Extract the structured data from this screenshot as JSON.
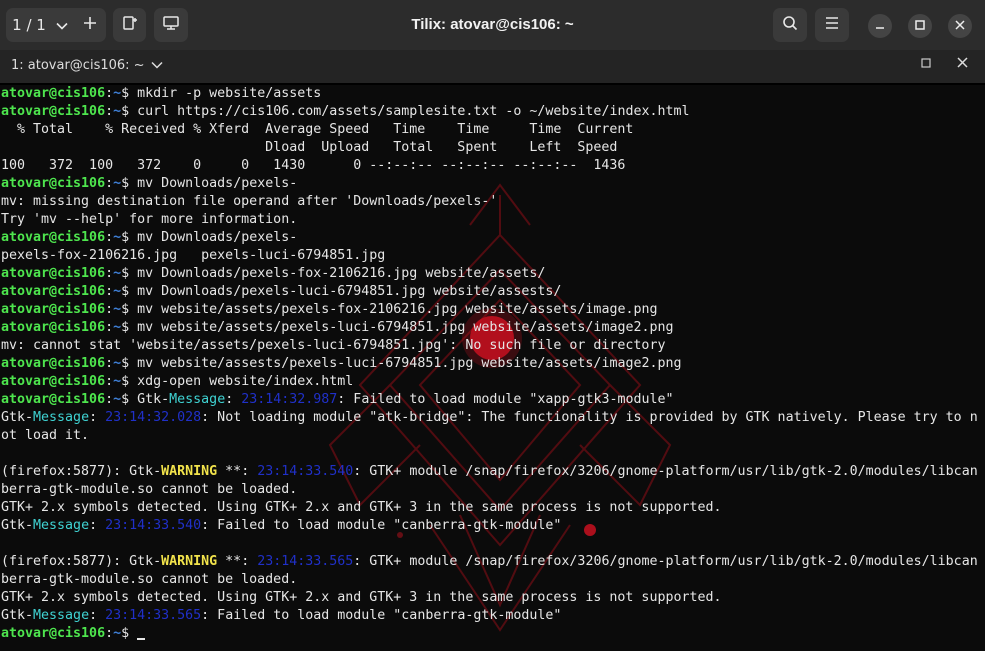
{
  "window": {
    "title": "Tilix: atovar@cis106: ~",
    "session_selector": "1 / 1",
    "tab_label": "1: atovar@cis106: ~"
  },
  "icons": {
    "add": "plus-icon",
    "split": "split-terminal-icon",
    "display": "display-icon",
    "search": "search-icon",
    "menu": "hamburger-menu-icon",
    "minimize": "minimize-icon",
    "maximize": "maximize-icon",
    "close": "close-icon",
    "chevron": "chevron-down-icon"
  },
  "colors": {
    "prompt_user": "#4ee64e",
    "prompt_path": "#3f7fd6",
    "gtk_message": "#3fd3d3",
    "gtk_warning": "#f2e34b",
    "timestamp": "#2030c8",
    "background": "#0b0b0b"
  },
  "terminal": {
    "lines": [
      {
        "type": "prompt",
        "user": "atovar@cis106",
        "path": "~",
        "cmd": "mkdir -p website/assets"
      },
      {
        "type": "prompt",
        "user": "atovar@cis106",
        "path": "~",
        "cmd": "curl https://cis106.com/assets/samplesite.txt -o ~/website/index.html"
      },
      {
        "type": "text",
        "text": "  % Total    % Received % Xferd  Average Speed   Time    Time     Time  Current"
      },
      {
        "type": "text",
        "text": "                                 Dload  Upload   Total   Spent    Left  Speed"
      },
      {
        "type": "text",
        "text": "100   372  100   372    0     0   1430      0 --:--:-- --:--:-- --:--:--  1436"
      },
      {
        "type": "prompt",
        "user": "atovar@cis106",
        "path": "~",
        "cmd": "mv Downloads/pexels-"
      },
      {
        "type": "text",
        "text": "mv: missing destination file operand after 'Downloads/pexels-'"
      },
      {
        "type": "text",
        "text": "Try 'mv --help' for more information."
      },
      {
        "type": "prompt",
        "user": "atovar@cis106",
        "path": "~",
        "cmd": "mv Downloads/pexels-"
      },
      {
        "type": "text",
        "text": "pexels-fox-2106216.jpg   pexels-luci-6794851.jpg"
      },
      {
        "type": "prompt",
        "user": "atovar@cis106",
        "path": "~",
        "cmd": "mv Downloads/pexels-fox-2106216.jpg website/assets/"
      },
      {
        "type": "prompt",
        "user": "atovar@cis106",
        "path": "~",
        "cmd": "mv Downloads/pexels-luci-6794851.jpg website/assests/"
      },
      {
        "type": "prompt",
        "user": "atovar@cis106",
        "path": "~",
        "cmd": "mv website/assets/pexels-fox-2106216.jpg website/assets/image.png"
      },
      {
        "type": "prompt",
        "user": "atovar@cis106",
        "path": "~",
        "cmd": "mv website/assets/pexels-luci-6794851.jpg website/assets/image2.png"
      },
      {
        "type": "text",
        "text": "mv: cannot stat 'website/assets/pexels-luci-6794851.jpg': No such file or directory"
      },
      {
        "type": "prompt",
        "user": "atovar@cis106",
        "path": "~",
        "cmd": "mv website/assests/pexels-luci-6794851.jpg website/assets/image2.png"
      },
      {
        "type": "prompt",
        "user": "atovar@cis106",
        "path": "~",
        "cmd": "xdg-open website/index.html"
      },
      {
        "type": "gtkprompt",
        "user": "atovar@cis106",
        "path": "~",
        "prefix": "Gtk-",
        "label": "Message",
        "ts": "23:14:32.987",
        "msg": ": Failed to load module \"xapp-gtk3-module\""
      },
      {
        "type": "gtk",
        "pre": "",
        "prefix": "Gtk-",
        "label": "Message",
        "sep": ": ",
        "ts": "23:14:32.028",
        "msg": ": Not loading module \"atk-bridge\": The functionality is provided by GTK natively. Please try to n",
        "kind": "msg"
      },
      {
        "type": "text",
        "text": "ot load it."
      },
      {
        "type": "blank"
      },
      {
        "type": "gtk",
        "pre": "(firefox:5877): ",
        "prefix": "Gtk-",
        "label": "WARNING",
        "sep": " **: ",
        "ts": "23:14:33.540",
        "msg": ": GTK+ module /snap/firefox/3206/gnome-platform/usr/lib/gtk-2.0/modules/libcan",
        "kind": "warn"
      },
      {
        "type": "text",
        "text": "berra-gtk-module.so cannot be loaded."
      },
      {
        "type": "text",
        "text": "GTK+ 2.x symbols detected. Using GTK+ 2.x and GTK+ 3 in the same process is not supported."
      },
      {
        "type": "gtk",
        "pre": "",
        "prefix": "Gtk-",
        "label": "Message",
        "sep": ": ",
        "ts": "23:14:33.540",
        "msg": ": Failed to load module \"canberra-gtk-module\"",
        "kind": "msg"
      },
      {
        "type": "blank"
      },
      {
        "type": "gtk",
        "pre": "(firefox:5877): ",
        "prefix": "Gtk-",
        "label": "WARNING",
        "sep": " **: ",
        "ts": "23:14:33.565",
        "msg": ": GTK+ module /snap/firefox/3206/gnome-platform/usr/lib/gtk-2.0/modules/libcan",
        "kind": "warn"
      },
      {
        "type": "text",
        "text": "berra-gtk-module.so cannot be loaded."
      },
      {
        "type": "text",
        "text": "GTK+ 2.x symbols detected. Using GTK+ 2.x and GTK+ 3 in the same process is not supported."
      },
      {
        "type": "gtk",
        "pre": "",
        "prefix": "Gtk-",
        "label": "Message",
        "sep": ": ",
        "ts": "23:14:33.565",
        "msg": ": Failed to load module \"canberra-gtk-module\"",
        "kind": "msg"
      },
      {
        "type": "prompt",
        "user": "atovar@cis106",
        "path": "~",
        "cmd": "",
        "cursor": true
      }
    ]
  }
}
